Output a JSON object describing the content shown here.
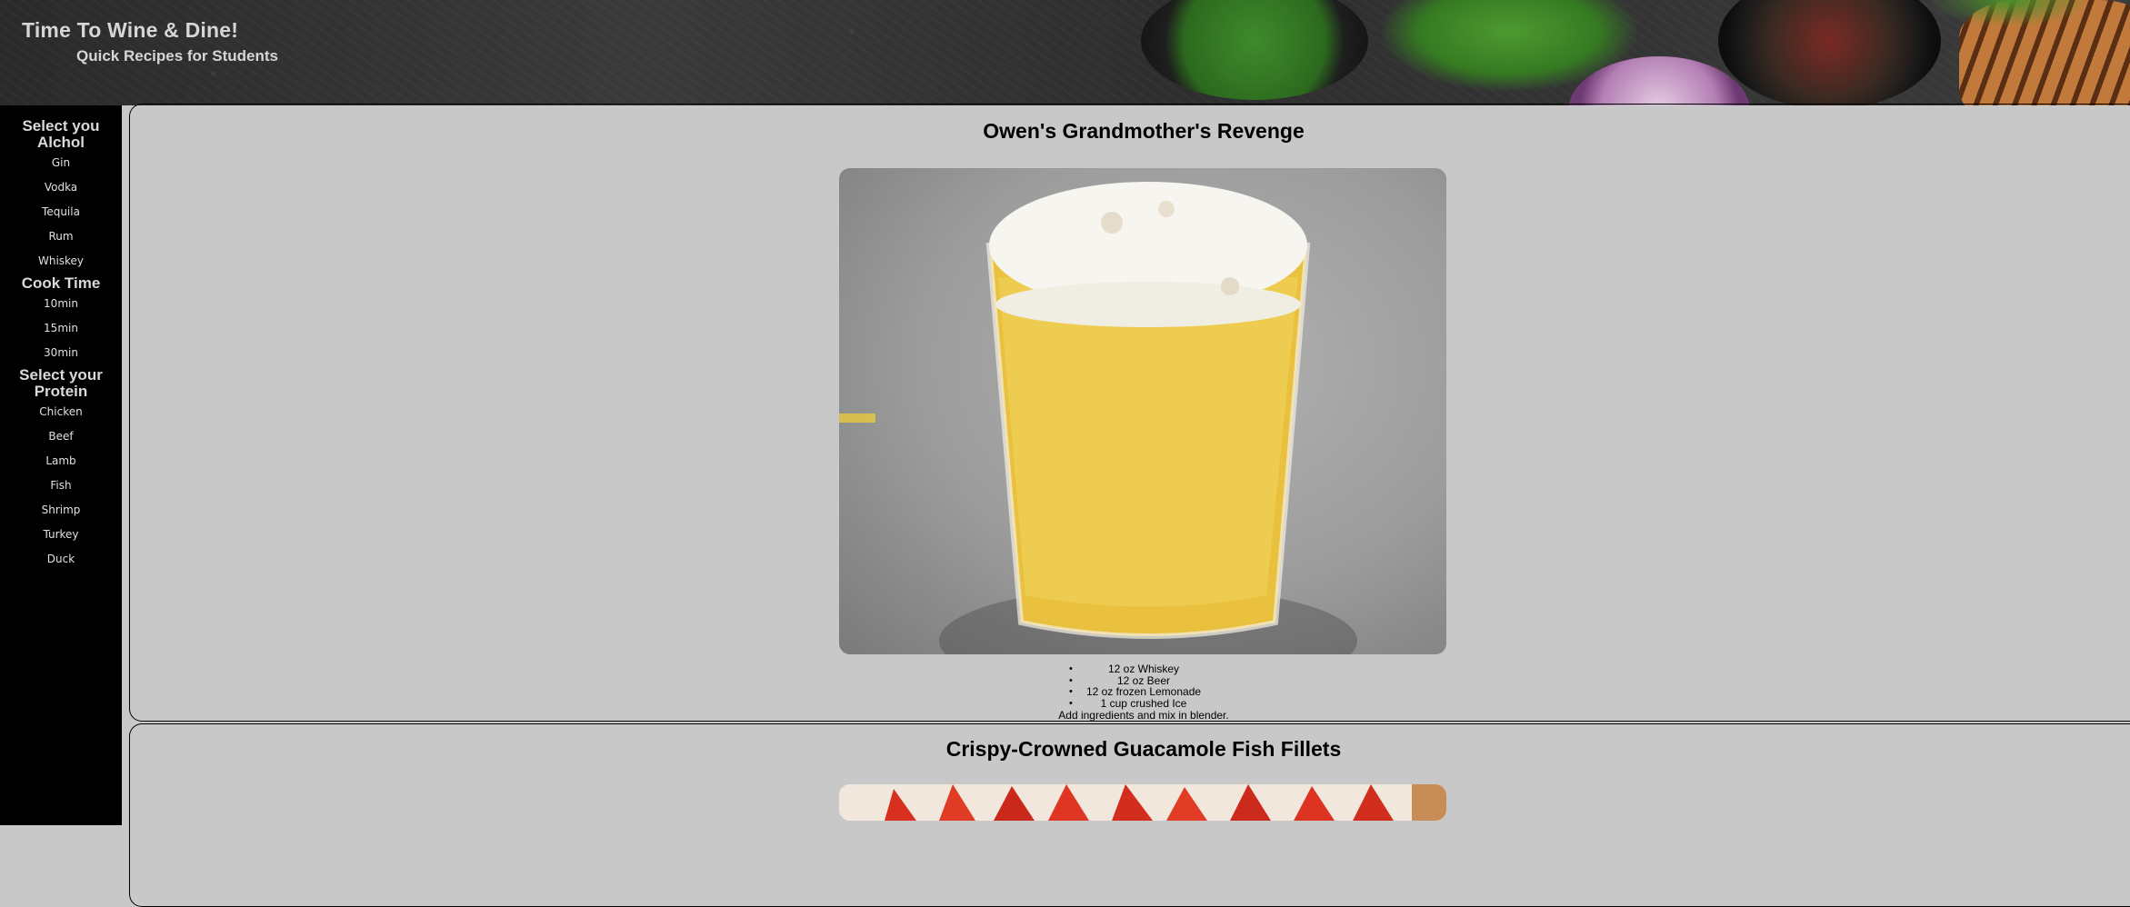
{
  "header": {
    "title": "Time To Wine & Dine!",
    "subtitle": "Quick Recipes for Students"
  },
  "sidebar": {
    "alcohol_heading": "Select you Alchol",
    "alcohol_items": [
      "Gin",
      "Vodka",
      "Tequila",
      "Rum",
      "Whiskey"
    ],
    "cook_time_heading": "Cook Time",
    "cook_time_items": [
      "10min",
      "15min",
      "30min"
    ],
    "protein_heading": "Select your Protein",
    "protein_items": [
      "Chicken",
      "Beef",
      "Lamb",
      "Fish",
      "Shrimp",
      "Turkey",
      "Duck"
    ]
  },
  "recipes": [
    {
      "title": "Owen's Grandmother's Revenge",
      "ingredients": [
        "12 oz Whiskey",
        "12 oz Beer",
        "12 oz frozen Lemonade",
        "1 cup crushed Ice"
      ],
      "instructions": "Add ingredients and mix in blender."
    },
    {
      "title": "Crispy-Crowned Guacamole Fish Fillets"
    }
  ],
  "colors": {
    "sidebar_bg": "#000000",
    "main_bg": "#c8c8c8",
    "header_text": "#d6d6d6"
  }
}
